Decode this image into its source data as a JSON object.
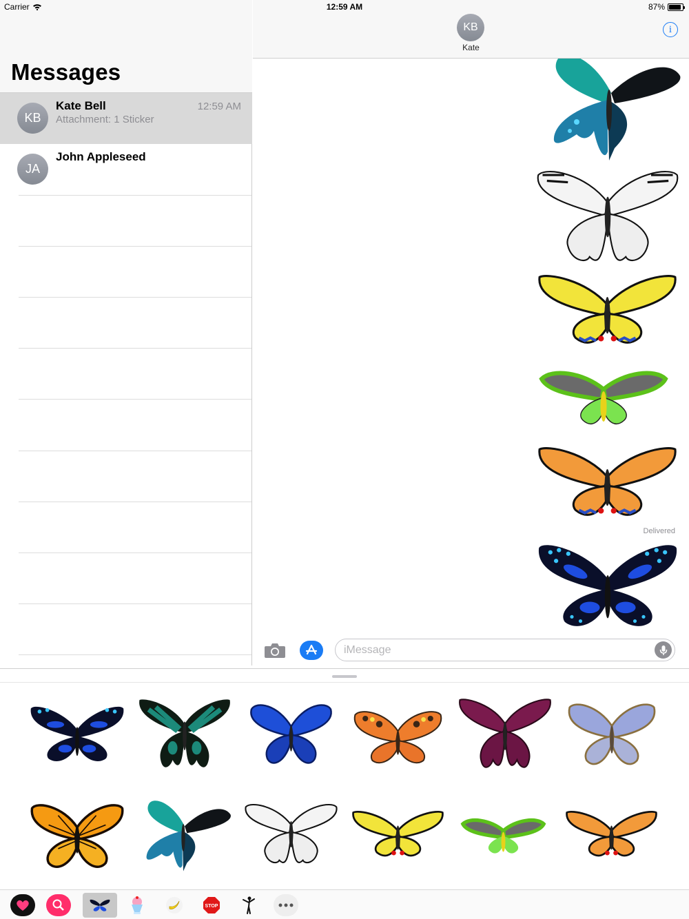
{
  "status_bar": {
    "carrier": "Carrier",
    "time": "12:59 AM",
    "battery": "87%",
    "battery_level": 0.87
  },
  "sidebar": {
    "title": "Messages",
    "conversations": [
      {
        "initials": "KB",
        "name": "Kate Bell",
        "preview": "Attachment: 1 Sticker",
        "time": "12:59 AM",
        "selected": true
      },
      {
        "initials": "JA",
        "name": "John Appleseed",
        "preview": "",
        "time": "",
        "selected": false
      }
    ]
  },
  "chat": {
    "contact_initials": "KB",
    "contact_name": "Kate",
    "delivered_label": "Delivered",
    "stickers": [
      "emerald-swallowtail",
      "white-swallowtail",
      "yellow-swallowtail",
      "green-birdwing",
      "orange-swallowtail",
      "blue-tiger"
    ]
  },
  "composer": {
    "placeholder": "iMessage"
  },
  "sticker_drawer": {
    "stickers": [
      "blue-tiger",
      "green-peacock",
      "blue-morpho",
      "tortoiseshell",
      "magenta-swallowtail",
      "lavender-morpho",
      "monarch",
      "emerald-swallowtail",
      "white-swallowtail",
      "yellow-swallowtail",
      "green-birdwing",
      "orange-swallowtail"
    ]
  },
  "app_tray": {
    "apps": [
      "heart-sticker-app",
      "search-images-app",
      "butterfly-stickers-app",
      "ice-cream-app",
      "banana-app",
      "stop-sign-app",
      "yoga-app",
      "more-apps"
    ],
    "active": "butterfly-stickers-app"
  },
  "colors": {
    "accent": "#1a7cf5",
    "header_bg": "#f7f7f7",
    "selected_row": "#d9d9d9"
  }
}
